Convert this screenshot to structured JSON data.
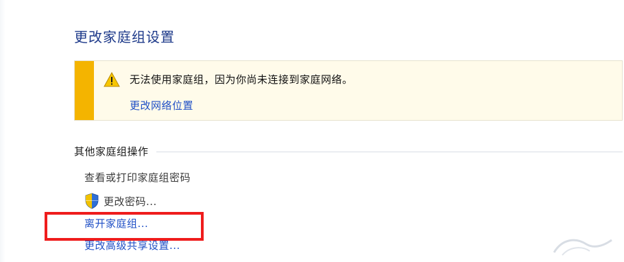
{
  "page": {
    "title": "更改家庭组设置"
  },
  "warning": {
    "message": "无法使用家庭组，因为你尚未连接到家庭网络。",
    "link_label": "更改网络位置",
    "icon": "warning-triangle-icon",
    "accent_color": "#f4b400"
  },
  "other_actions": {
    "heading": "其他家庭组操作",
    "items": [
      {
        "label": "查看或打印家庭组密码",
        "icon": null
      },
      {
        "label": "更改密码...",
        "icon": "uac-shield-icon"
      },
      {
        "label": "离开家庭组...",
        "icon": null
      },
      {
        "label": "更改高级共享设置...",
        "icon": null
      }
    ]
  },
  "annotation": {
    "highlight_color": "#ef1c1c"
  },
  "colors": {
    "title": "#1e3a8a",
    "link": "#1f4fc6"
  }
}
